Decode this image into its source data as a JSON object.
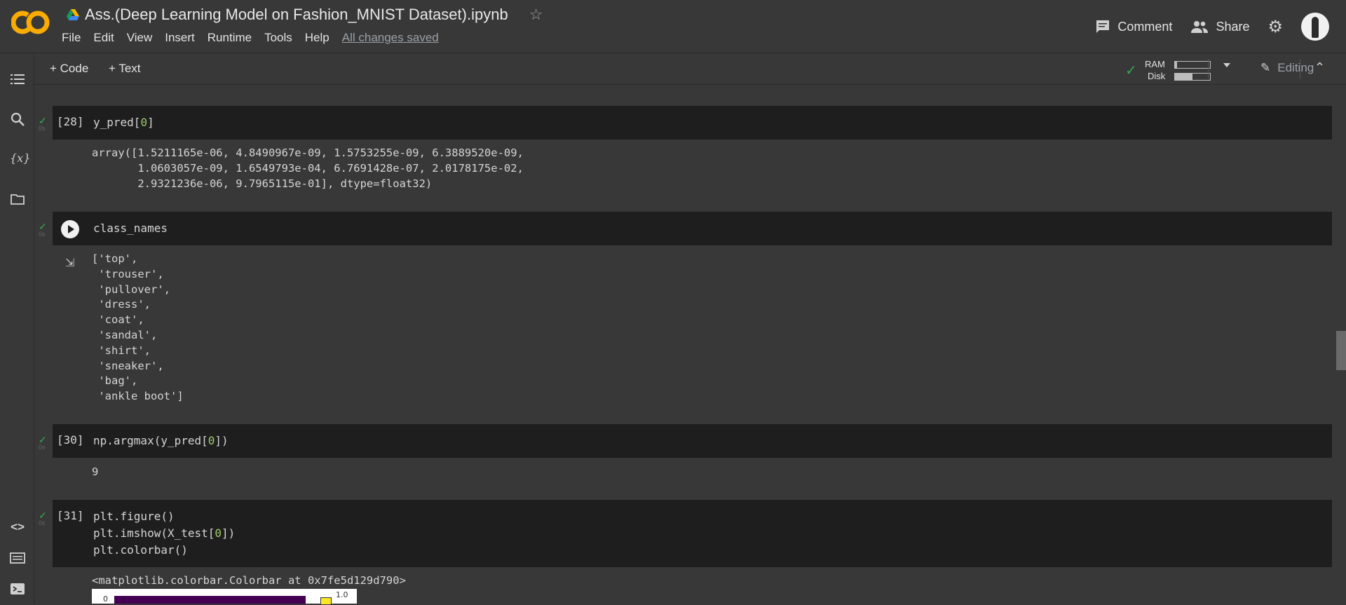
{
  "header": {
    "doc_title": "Ass.(Deep Learning Model on Fashion_MNIST Dataset).ipynb",
    "menu": [
      "File",
      "Edit",
      "View",
      "Insert",
      "Runtime",
      "Tools",
      "Help"
    ],
    "saved_status": "All changes saved",
    "comment_label": "Comment",
    "share_label": "Share"
  },
  "toolbar": {
    "add_code": "+ Code",
    "add_text": "+ Text",
    "ram_label": "RAM",
    "disk_label": "Disk",
    "ram_usage": 0.05,
    "disk_usage": 0.5,
    "editing_label": "Editing"
  },
  "cells": {
    "c28": {
      "exec": "[28]",
      "code": "y_pred[0]",
      "time": "0s",
      "output": "array([1.5211165e-06, 4.8490967e-09, 1.5753255e-09, 6.3889520e-09,\n       1.0603057e-09, 1.6549793e-04, 6.7691428e-07, 2.0178175e-02,\n       2.9321236e-06, 9.7965115e-01], dtype=float32)"
    },
    "c29": {
      "code": "class_names",
      "time": "0s",
      "output": "['top',\n 'trouser',\n 'pullover',\n 'dress',\n 'coat',\n 'sandal',\n 'shirt',\n 'sneaker',\n 'bag',\n 'ankle boot']"
    },
    "c30": {
      "exec": "[30]",
      "code": "np.argmax(y_pred[0])",
      "time": "0s",
      "output": "9"
    },
    "c31": {
      "exec": "[31]",
      "code": "plt.figure()\nplt.imshow(X_test[0])\nplt.colorbar()",
      "time": "0s",
      "output": "<matplotlib.colorbar.Colorbar at 0x7fe5d129d790>",
      "plot_tick_y": "0",
      "plot_tick_cbar": "1.0"
    }
  },
  "colors": {
    "background": "#383838",
    "cell_bg": "#1e1e1e",
    "success": "#34a853",
    "plot_dark": "#440154",
    "plot_yellow": "#fde725"
  },
  "icons": [
    "colab-logo",
    "drive-icon",
    "star-icon",
    "comment-icon",
    "share-icon",
    "gear-icon",
    "avatar",
    "toc-icon",
    "search-icon",
    "variables-icon",
    "folder-icon",
    "code-snippets-icon",
    "command-palette-icon",
    "terminal-icon",
    "check-icon",
    "dropdown-icon",
    "pencil-icon",
    "collapse-icon",
    "run-icon",
    "output-icon"
  ]
}
